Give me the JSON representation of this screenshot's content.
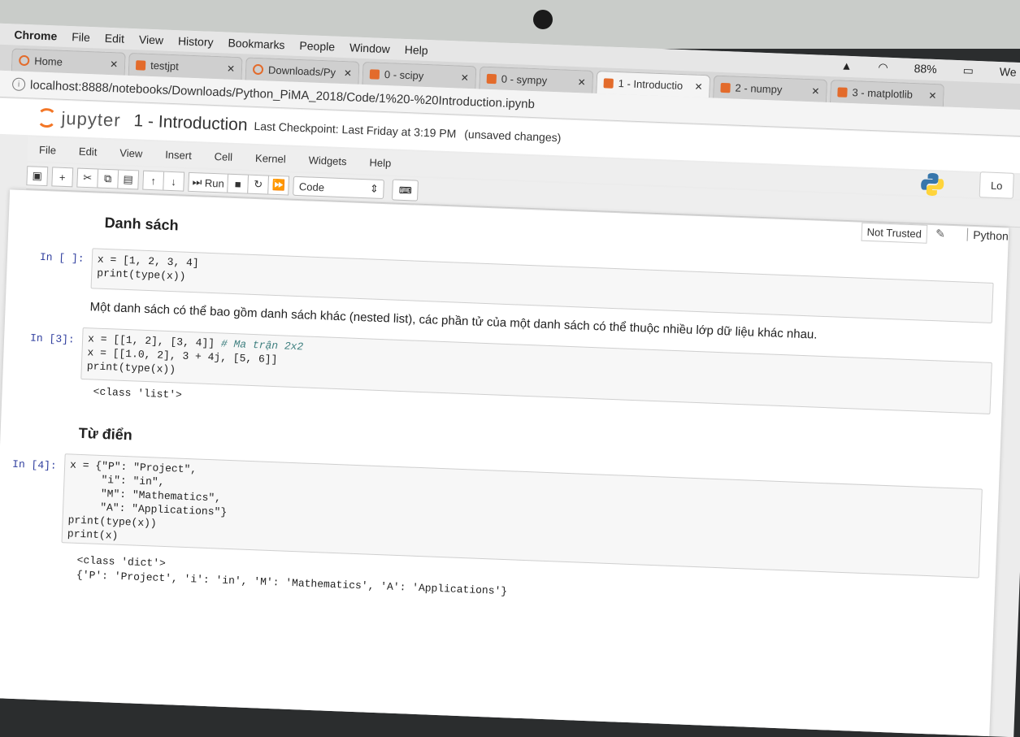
{
  "menubar": {
    "app": "Chrome",
    "items": [
      "File",
      "Edit",
      "View",
      "History",
      "Bookmarks",
      "People",
      "Window",
      "Help"
    ],
    "battery": "88%",
    "user": "We"
  },
  "tabs": [
    {
      "label": "Home",
      "icon": "round"
    },
    {
      "label": "testjpt",
      "icon": "book"
    },
    {
      "label": "Downloads/Py",
      "icon": "round"
    },
    {
      "label": "0 - scipy",
      "icon": "book"
    },
    {
      "label": "0 - sympy",
      "icon": "book"
    },
    {
      "label": "1 - Introductio",
      "icon": "book",
      "active": true
    },
    {
      "label": "2 - numpy",
      "icon": "book"
    },
    {
      "label": "3 - matplotlib",
      "icon": "book"
    }
  ],
  "address": {
    "url": "localhost:8888/notebooks/Downloads/Python_PiMA_2018/Code/1%20-%20Introduction.ipynb"
  },
  "jupyter": {
    "logo": "jupyter",
    "title": "1 - Introduction",
    "checkpoint": "Last Checkpoint: Last Friday at 3:19 PM",
    "unsaved": "(unsaved changes)"
  },
  "menu": [
    "File",
    "Edit",
    "View",
    "Insert",
    "Cell",
    "Kernel",
    "Widgets",
    "Help"
  ],
  "toolbar": {
    "run": "Run",
    "celltype": "Code"
  },
  "trusted": "Not Trusted",
  "kernel": "Python",
  "logout": "Lo",
  "cells": {
    "h_list": "Danh sách",
    "p1": "In [ ]:",
    "p1_line1": "x = [1, 2, 3, 4]",
    "p1_line2": "print(type(x))",
    "md": "Một danh sách có thể bao gồm danh sách khác (nested list), các phần tử của một danh sách có thể thuộc nhiều lớp dữ liệu khác nhau.",
    "p2": "In [3]:",
    "p2_line1": "x = [[1, 2], [3, 4]] ",
    "p2_comment": "# Ma trận 2x2",
    "p2_line2": "x = [[1.0, 2], 3 + 4j, [5, 6]]",
    "p2_line3": "print(type(x))",
    "out2": "<class 'list'>",
    "h_dict": "Từ điển",
    "p3": "In [4]:",
    "p3_lines": [
      "x = {\"P\": \"Project\",",
      "     \"i\": \"in\",",
      "     \"M\": \"Mathematics\",",
      "     \"A\": \"Applications\"}",
      "print(type(x))",
      "print(x)"
    ],
    "out3_line1": "<class 'dict'>",
    "out3_line2": "{'P': 'Project', 'i': 'in', 'M': 'Mathematics', 'A': 'Applications'}"
  }
}
